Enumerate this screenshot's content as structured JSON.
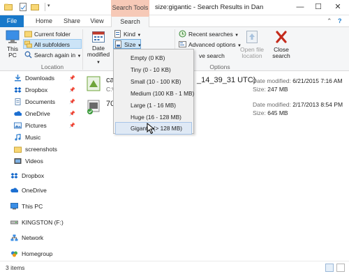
{
  "window": {
    "title": "size:gigantic - Search Results in Dan",
    "contextual_tab_group": "Search Tools",
    "controls": {
      "minimize": "—",
      "maximize": "☐",
      "close": "✕"
    }
  },
  "tabs": {
    "file": "File",
    "home": "Home",
    "share": "Share",
    "view": "View",
    "search": "Search"
  },
  "ribbon": {
    "location": {
      "this_pc": "This PC",
      "current_folder": "Current folder",
      "all_subfolders": "All subfolders",
      "search_again_in": "Search again in",
      "group_label": "Location"
    },
    "refine": {
      "date_modified_line1": "Date",
      "date_modified_line2": "modified",
      "kind": "Kind",
      "size": "Size"
    },
    "options": {
      "recent_searches": "Recent searches",
      "advanced_options": "Advanced options",
      "save_search": "ve search",
      "open_file_location_line1": "Open file",
      "open_file_location_line2": "location",
      "close_search_line1": "Close",
      "close_search_line2": "search",
      "group_label": "Options"
    }
  },
  "size_menu": {
    "items": [
      "Empty (0 KB)",
      "Tiny (0 - 10 KB)",
      "Small (10 - 100 KB)",
      "Medium (100 KB - 1 MB)",
      "Large (1 - 16 MB)",
      "Huge (16 - 128 MB)",
      "Gigantic (> 128 MB)"
    ],
    "highlighted_index": 6
  },
  "nav": {
    "quick_access": [
      {
        "label": "Downloads",
        "pinned": true
      },
      {
        "label": "Dropbox",
        "pinned": true
      },
      {
        "label": "Documents",
        "pinned": true
      },
      {
        "label": "OneDrive",
        "pinned": true
      },
      {
        "label": "Pictures",
        "pinned": true
      },
      {
        "label": "Music",
        "pinned": false
      },
      {
        "label": "screenshots",
        "pinned": false
      },
      {
        "label": "Videos",
        "pinned": false
      }
    ],
    "roots": [
      "Dropbox",
      "OneDrive",
      "This PC",
      "KINGSTON (F:)",
      "Network",
      "Homegroup"
    ]
  },
  "results": [
    {
      "name": "ca",
      "name_tail": "_14_39_31 UTC)",
      "path": "C:\\",
      "date_label": "Date modified:",
      "date": "6/21/2015 7:16 AM",
      "size_label": "Size:",
      "size": "247 MB"
    },
    {
      "name": "70",
      "name_tail": "",
      "path": "",
      "date_label": "Date modified:",
      "date": "2/17/2013 8:54 PM",
      "size_label": "Size:",
      "size": "645 MB"
    }
  ],
  "status": {
    "items": "3 items"
  },
  "colors": {
    "file_tab": "#1979ca",
    "search_tools": "#f6c9b7",
    "hover_bg": "#dfe9f5",
    "close_red": "#c42b1c"
  }
}
